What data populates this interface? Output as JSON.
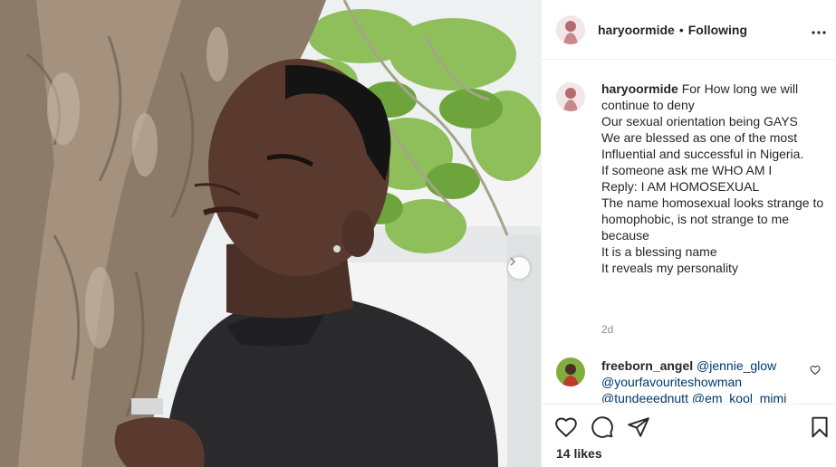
{
  "post": {
    "username": "haryoormide",
    "separator": "•",
    "follow_label": "Following",
    "caption_lines": [
      "For How long we will continue to deny",
      "Our sexual orientation being GAYS",
      "We are blessed as one of the most Influential and successful in Nigeria.",
      "",
      "If someone ask me WHO AM I",
      "Reply: I AM HOMOSEXUAL",
      "",
      "The name homosexual looks strange to homophobic, is not strange to me because",
      "It is a blessing name",
      "It reveals my personality"
    ],
    "age": "2d",
    "likes": "14 likes"
  },
  "comment": {
    "username": "freeborn_angel",
    "mentions": [
      "@jennie_glow",
      "@yourfavouriteshowman",
      "@tundeeednutt",
      "@em_kool_mimi"
    ]
  },
  "icons": {
    "more": "more-horizontal-icon",
    "next": "chevron-right-icon",
    "like": "heart-icon",
    "comment": "comment-bubble-icon",
    "share": "paper-plane-icon",
    "save": "bookmark-icon"
  },
  "colors": {
    "text": "#262626",
    "muted": "#8e8e8e",
    "mention": "#00376b",
    "divider": "#efefef"
  }
}
